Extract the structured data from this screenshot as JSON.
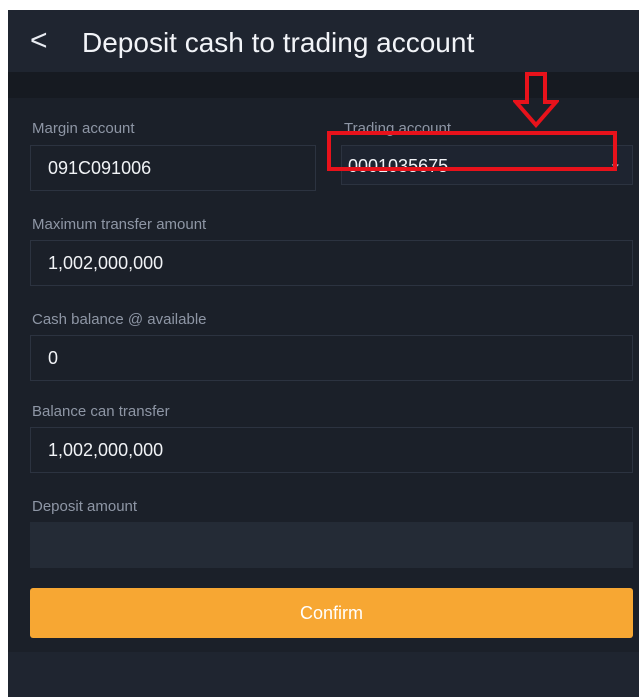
{
  "header": {
    "back_icon": "chevron-left-icon",
    "back_glyph": "<",
    "title": "Deposit cash to trading account"
  },
  "form": {
    "margin_account": {
      "label": "Margin account",
      "value": "091C091006"
    },
    "trading_account": {
      "label": "Trading account",
      "value": "0001035675",
      "dropdown_icon": "chevron-down-icon",
      "dropdown_glyph": "⌄"
    },
    "max_transfer": {
      "label": "Maximum transfer amount",
      "value": "1,002,000,000"
    },
    "cash_balance": {
      "label": "Cash balance @ available",
      "value": "0"
    },
    "balance_can_transfer": {
      "label": "Balance can transfer",
      "value": "1,002,000,000"
    },
    "deposit_amount": {
      "label": "Deposit amount",
      "value": ""
    }
  },
  "actions": {
    "confirm_label": "Confirm"
  },
  "annotation": {
    "arrow_icon": "down-arrow-icon",
    "highlight_color": "#e8121b"
  },
  "colors": {
    "accent": "#f7a733",
    "background": "#1b2029"
  }
}
